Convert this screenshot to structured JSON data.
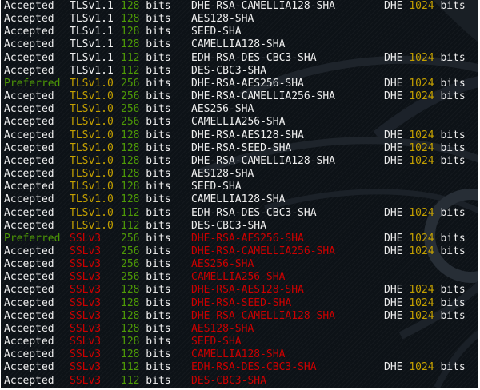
{
  "app": "terminal-sslscan-output",
  "colors": {
    "background": "#0d1217",
    "white": "#eeeeee",
    "green": "#4e9a06",
    "yellow": "#c4a000",
    "red": "#cc0000",
    "watermark_stroke": "#20262d",
    "watermark_stroke_light": "#272e36"
  },
  "labels": {
    "bits_unit": "bits",
    "kex_dhe": "DHE",
    "kex_bits": "1024",
    "kex_unit": "bits"
  },
  "version_colors": {
    "TLSv1.1": "white",
    "TLSv1.0": "yellow",
    "SSLv3": "red"
  },
  "status_colors": {
    "Accepted": "white",
    "Preferred": "green"
  },
  "terminal": {
    "rows": [
      {
        "status": "Accepted",
        "version": "TLSv1.1",
        "bits": "128",
        "cipher": "DHE-RSA-CAMELLIA128-SHA",
        "kex": true,
        "cipher_red": false
      },
      {
        "status": "Accepted",
        "version": "TLSv1.1",
        "bits": "128",
        "cipher": "AES128-SHA",
        "kex": false,
        "cipher_red": false
      },
      {
        "status": "Accepted",
        "version": "TLSv1.1",
        "bits": "128",
        "cipher": "SEED-SHA",
        "kex": false,
        "cipher_red": false
      },
      {
        "status": "Accepted",
        "version": "TLSv1.1",
        "bits": "128",
        "cipher": "CAMELLIA128-SHA",
        "kex": false,
        "cipher_red": false
      },
      {
        "status": "Accepted",
        "version": "TLSv1.1",
        "bits": "112",
        "cipher": "EDH-RSA-DES-CBC3-SHA",
        "kex": true,
        "cipher_red": false
      },
      {
        "status": "Accepted",
        "version": "TLSv1.1",
        "bits": "112",
        "cipher": "DES-CBC3-SHA",
        "kex": false,
        "cipher_red": false
      },
      {
        "status": "Preferred",
        "version": "TLSv1.0",
        "bits": "256",
        "cipher": "DHE-RSA-AES256-SHA",
        "kex": true,
        "cipher_red": false
      },
      {
        "status": "Accepted",
        "version": "TLSv1.0",
        "bits": "256",
        "cipher": "DHE-RSA-CAMELLIA256-SHA",
        "kex": true,
        "cipher_red": false
      },
      {
        "status": "Accepted",
        "version": "TLSv1.0",
        "bits": "256",
        "cipher": "AES256-SHA",
        "kex": false,
        "cipher_red": false
      },
      {
        "status": "Accepted",
        "version": "TLSv1.0",
        "bits": "256",
        "cipher": "CAMELLIA256-SHA",
        "kex": false,
        "cipher_red": false
      },
      {
        "status": "Accepted",
        "version": "TLSv1.0",
        "bits": "128",
        "cipher": "DHE-RSA-AES128-SHA",
        "kex": true,
        "cipher_red": false
      },
      {
        "status": "Accepted",
        "version": "TLSv1.0",
        "bits": "128",
        "cipher": "DHE-RSA-SEED-SHA",
        "kex": true,
        "cipher_red": false
      },
      {
        "status": "Accepted",
        "version": "TLSv1.0",
        "bits": "128",
        "cipher": "DHE-RSA-CAMELLIA128-SHA",
        "kex": true,
        "cipher_red": false
      },
      {
        "status": "Accepted",
        "version": "TLSv1.0",
        "bits": "128",
        "cipher": "AES128-SHA",
        "kex": false,
        "cipher_red": false
      },
      {
        "status": "Accepted",
        "version": "TLSv1.0",
        "bits": "128",
        "cipher": "SEED-SHA",
        "kex": false,
        "cipher_red": false
      },
      {
        "status": "Accepted",
        "version": "TLSv1.0",
        "bits": "128",
        "cipher": "CAMELLIA128-SHA",
        "kex": false,
        "cipher_red": false
      },
      {
        "status": "Accepted",
        "version": "TLSv1.0",
        "bits": "112",
        "cipher": "EDH-RSA-DES-CBC3-SHA",
        "kex": true,
        "cipher_red": false
      },
      {
        "status": "Accepted",
        "version": "TLSv1.0",
        "bits": "112",
        "cipher": "DES-CBC3-SHA",
        "kex": false,
        "cipher_red": false
      },
      {
        "status": "Preferred",
        "version": "SSLv3",
        "bits": "256",
        "cipher": "DHE-RSA-AES256-SHA",
        "kex": true,
        "cipher_red": true
      },
      {
        "status": "Accepted",
        "version": "SSLv3",
        "bits": "256",
        "cipher": "DHE-RSA-CAMELLIA256-SHA",
        "kex": true,
        "cipher_red": true
      },
      {
        "status": "Accepted",
        "version": "SSLv3",
        "bits": "256",
        "cipher": "AES256-SHA",
        "kex": false,
        "cipher_red": true
      },
      {
        "status": "Accepted",
        "version": "SSLv3",
        "bits": "256",
        "cipher": "CAMELLIA256-SHA",
        "kex": false,
        "cipher_red": true
      },
      {
        "status": "Accepted",
        "version": "SSLv3",
        "bits": "128",
        "cipher": "DHE-RSA-AES128-SHA",
        "kex": true,
        "cipher_red": true
      },
      {
        "status": "Accepted",
        "version": "SSLv3",
        "bits": "128",
        "cipher": "DHE-RSA-SEED-SHA",
        "kex": true,
        "cipher_red": true
      },
      {
        "status": "Accepted",
        "version": "SSLv3",
        "bits": "128",
        "cipher": "DHE-RSA-CAMELLIA128-SHA",
        "kex": true,
        "cipher_red": true
      },
      {
        "status": "Accepted",
        "version": "SSLv3",
        "bits": "128",
        "cipher": "AES128-SHA",
        "kex": false,
        "cipher_red": true
      },
      {
        "status": "Accepted",
        "version": "SSLv3",
        "bits": "128",
        "cipher": "SEED-SHA",
        "kex": false,
        "cipher_red": true
      },
      {
        "status": "Accepted",
        "version": "SSLv3",
        "bits": "128",
        "cipher": "CAMELLIA128-SHA",
        "kex": false,
        "cipher_red": true
      },
      {
        "status": "Accepted",
        "version": "SSLv3",
        "bits": "112",
        "cipher": "EDH-RSA-DES-CBC3-SHA",
        "kex": true,
        "cipher_red": true
      },
      {
        "status": "Accepted",
        "version": "SSLv3",
        "bits": "112",
        "cipher": "DES-CBC3-SHA",
        "kex": false,
        "cipher_red": true
      }
    ]
  }
}
